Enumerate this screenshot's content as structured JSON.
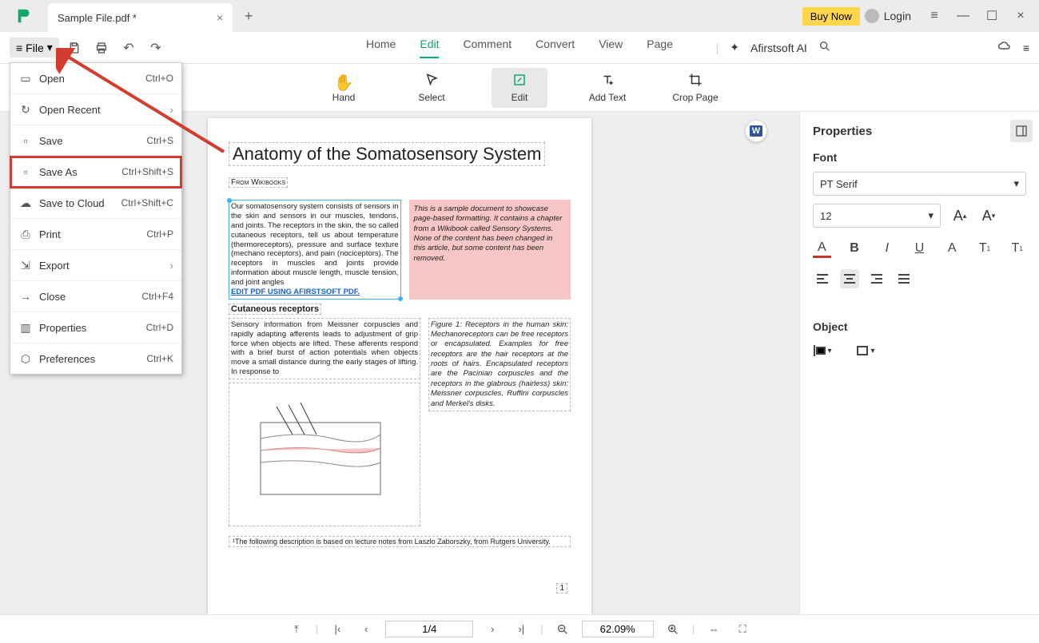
{
  "titlebar": {
    "tab_name": "Sample File.pdf *",
    "buy_now": "Buy Now",
    "login": "Login"
  },
  "menubar": {
    "file": "File",
    "tabs": [
      "Home",
      "Edit",
      "Comment",
      "Convert",
      "View",
      "Page"
    ],
    "active_tab": "Edit",
    "ai": "Afirstsoft AI"
  },
  "toolbar": {
    "hand": "Hand",
    "select": "Select",
    "edit": "Edit",
    "add_text": "Add Text",
    "crop_page": "Crop Page"
  },
  "file_menu": {
    "open": {
      "label": "Open",
      "shortcut": "Ctrl+O"
    },
    "open_recent": {
      "label": "Open Recent"
    },
    "save": {
      "label": "Save",
      "shortcut": "Ctrl+S"
    },
    "save_as": {
      "label": "Save As",
      "shortcut": "Ctrl+Shift+S"
    },
    "save_to_cloud": {
      "label": "Save to Cloud",
      "shortcut": "Ctrl+Shift+C"
    },
    "print": {
      "label": "Print",
      "shortcut": "Ctrl+P"
    },
    "export": {
      "label": "Export"
    },
    "close": {
      "label": "Close",
      "shortcut": "Ctrl+F4"
    },
    "properties": {
      "label": "Properties",
      "shortcut": "Ctrl+D"
    },
    "preferences": {
      "label": "Preferences",
      "shortcut": "Ctrl+K"
    }
  },
  "document": {
    "title": "Anatomy of the Somatosensory System",
    "from": "From Wikibooks",
    "para1": "Our somatosensory system consists of sensors in the skin and sensors in our muscles, tendons, and joints. The receptors in the skin, the so called cutaneous receptors, tell us about temperature (thermoreceptors), pressure and surface texture (mechano receptors), and pain (nociceptors). The receptors in muscles and joints provide information about muscle length, muscle tension, and joint angles",
    "editlink": "EDIT PDF USING AFIRSTSOFT PDF.",
    "callout": "This is a sample document to showcase page-based formatting. It contains a chapter from a Wikibook called Sensory Systems. None of the content has been changed in this article, but some content has been removed.",
    "subhead": "Cutaneous receptors",
    "para2": "Sensory information from Meissner corpuscles and rapidly adapting afferents leads to adjustment of grip force when objects are lifted. These afferents respond with a brief burst of action potentials when objects move a small distance during the early stages of lifting. In response to",
    "figcap": "Figure 1: Receptors in the human skin: Mechanoreceptors can be free receptors or encapsulated. Examples for free receptors are the hair receptors at the roots of hairs. Encapsulated receptors are the Pacinian corpuscles and the receptors in the glabrous (hairless) skin: Meissner corpuscles, Ruffini corpuscles and Merkel's disks.",
    "footnote": "¹The following description is based on lecture notes from Laszlo Zaborszky, from Rutgers University.",
    "pagenum": "1"
  },
  "properties": {
    "title": "Properties",
    "font_label": "Font",
    "font_family": "PT Serif",
    "font_size": "12",
    "object_label": "Object"
  },
  "status": {
    "page": "1/4",
    "zoom": "62.09%"
  }
}
